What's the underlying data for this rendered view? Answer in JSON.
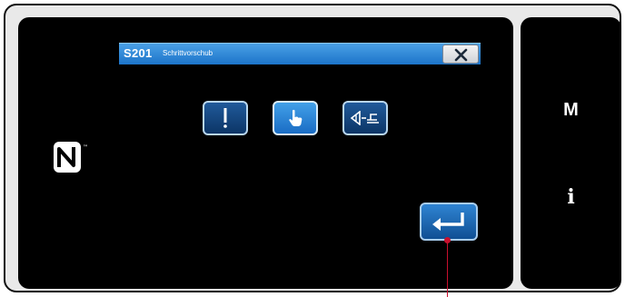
{
  "dialog": {
    "code": "S201",
    "title": "Schrittvorschub",
    "buttons": [
      {
        "icon": "needle-icon",
        "selected": false
      },
      {
        "icon": "hand-pointer-icon",
        "selected": true
      },
      {
        "icon": "feed-step-icon",
        "selected": false
      }
    ],
    "close_icon": "close-icon",
    "enter_icon": "enter-icon"
  },
  "side_panel": {
    "mode_key": "M",
    "info_key": "i"
  },
  "colors": {
    "titlebar": "#1c74c9",
    "button_normal": "#0c3566",
    "button_selected": "#2b86d8",
    "callout": "#c8102e"
  }
}
